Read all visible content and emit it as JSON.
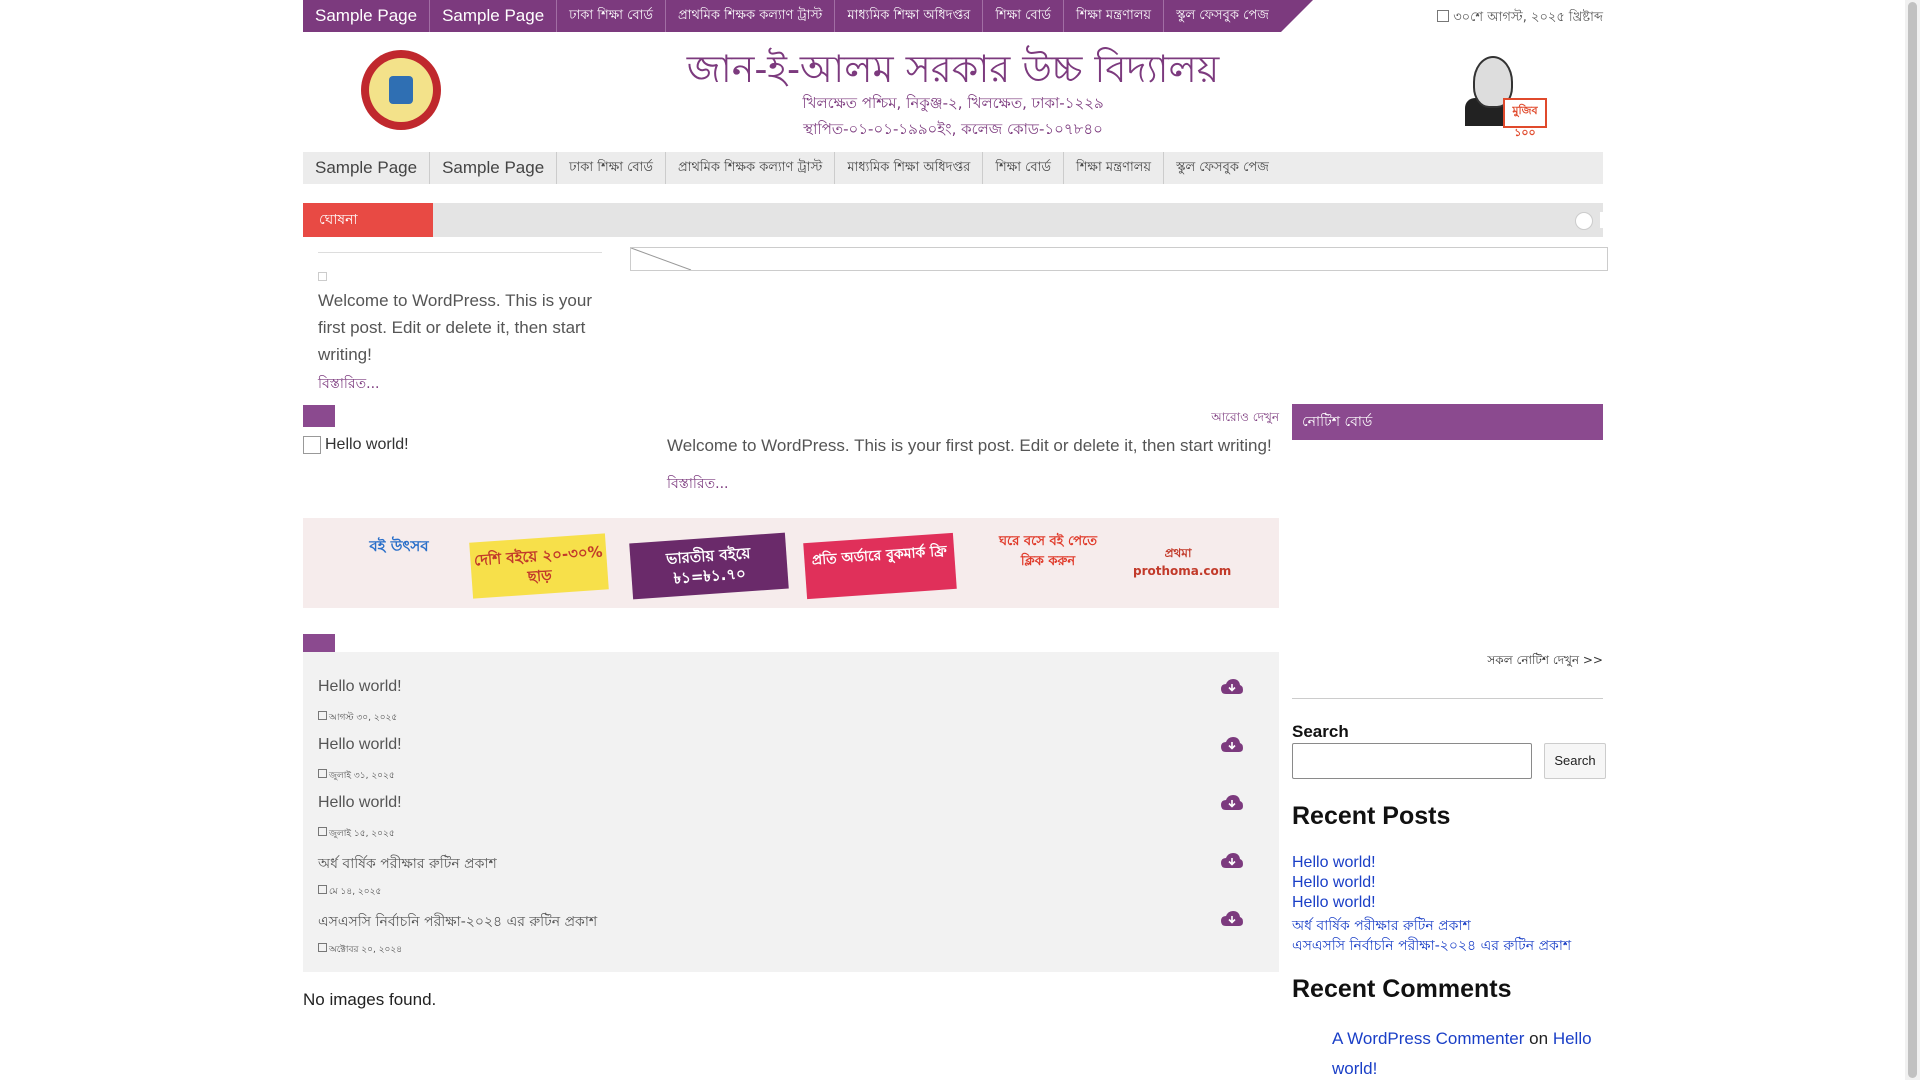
{
  "top_nav": {
    "items": [
      "Sample Page",
      "Sample Page",
      "ঢাকা শিক্ষা বোর্ড",
      "প্রাথমিক শিক্ষক কল্যাণ ট্রাস্ট",
      "মাধ্যমিক শিক্ষা অধিদপ্তর",
      "শিক্ষা বোর্ড",
      "শিক্ষা মন্ত্রণালয়",
      "স্কুল ফেসবুক পেজ"
    ],
    "date": "৩০শে আগস্ট, ২০২৫ খ্রিষ্টাব্দ"
  },
  "header": {
    "title": "জান-ই-আলম সরকার উচ্চ বিদ্যালয়",
    "address": "খিলক্ষেত পশ্চিম, নিকুঞ্জ-২, খিলক্ষেত, ঢাকা-১২২৯",
    "established": "স্থাপিত-০১-০১-১৯৯০ইং, কলেজ কোড-১০৭৮৪০",
    "portrait_tag": "মুজিব ১০০"
  },
  "main_nav": {
    "items": [
      "Sample Page",
      "Sample Page",
      "ঢাকা শিক্ষা বোর্ড",
      "প্রাথমিক শিক্ষক কল্যাণ ট্রাস্ট",
      "মাধ্যমিক শিক্ষা অধিদপ্তর",
      "শিক্ষা বোর্ড",
      "শিক্ষা মন্ত্রণালয়",
      "স্কুল ফেসবুক পেজ"
    ]
  },
  "ticker": {
    "label": "ঘোষনা"
  },
  "featured": {
    "excerpt": "Welcome to WordPress. This is your first post. Edit or delete it, then start writing!",
    "read_more": "বিস্তারিত..."
  },
  "section_a": {
    "more_link": "আরোও দেখুন",
    "image_alt": "Hello world!",
    "excerpt": "Welcome to WordPress. This is your first post. Edit or delete it, then start writing!",
    "read_more": "বিস্তারিত..."
  },
  "banner": {
    "items": [
      "বই উৎসব",
      "দেশি বইয়ে ২০-৩০% ছাড়",
      "ভারতীয় বইয়ে ৳১=৳১.৭০",
      "প্রতি অর্ডারে বুকমার্ক ফ্রি",
      "ঘরে বসে বই পেতে ক্লিক করুন",
      "প্রথমা prothoma.com"
    ]
  },
  "downloads": {
    "items": [
      {
        "title": "Hello world!",
        "date": "আগস্ট ৩০, ২০২৫"
      },
      {
        "title": "Hello world!",
        "date": "জুলাই ৩১, ২০২৫"
      },
      {
        "title": "Hello world!",
        "date": "জুলাই ১৫, ২০২৫"
      },
      {
        "title": "অর্ধ বার্ষিক পরীক্ষার রুটিন প্রকাশ",
        "date": "মে ১৪, ২০২৫"
      },
      {
        "title": "এসএসসি নির্বাচনি পরীক্ষা-২০২৪ এর রুটিন প্রকাশ",
        "date": "অক্টোবর ২০, ২০২৪"
      }
    ],
    "no_images": "No images found."
  },
  "sidebar": {
    "notice_board": "নোটিশ বোর্ড",
    "all_notices": "সকল নোটিশ দেখুন >>",
    "search_label": "Search",
    "search_button": "Search",
    "recent_posts_title": "Recent Posts",
    "recent_posts": [
      "Hello world!",
      "Hello world!",
      "Hello world!",
      "অর্ধ বার্ষিক পরীক্ষার রুটিন প্রকাশ",
      "এসএসসি নির্বাচনি পরীক্ষা-২০২৪ এর রুটিন প্রকাশ"
    ],
    "recent_comments_title": "Recent Comments",
    "comment_author": "A WordPress Commenter",
    "comment_on": "on",
    "comment_post": "Hello world!"
  },
  "colors": {
    "accent": "#7c3a7e",
    "ticker_label": "#e84a44",
    "link": "#1a3fc7"
  }
}
